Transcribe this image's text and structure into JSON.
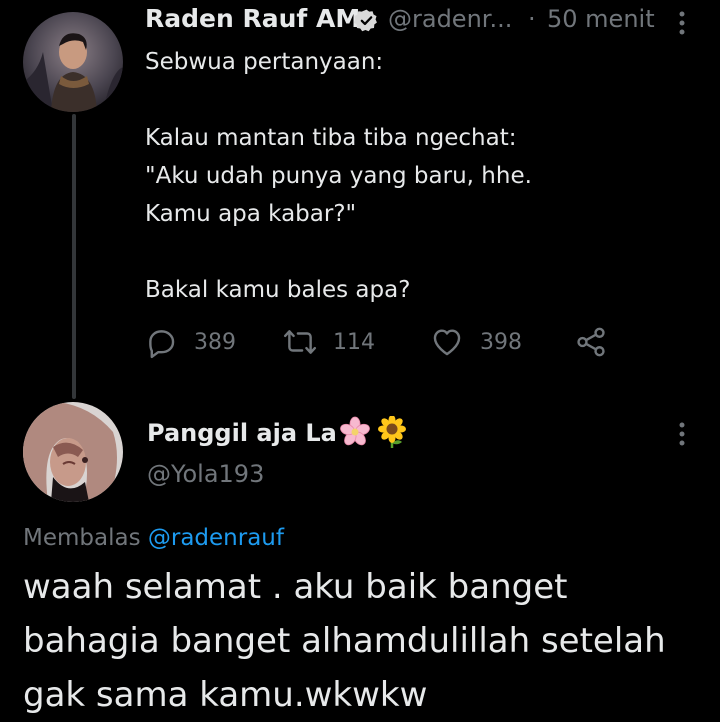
{
  "parent_tweet": {
    "author_name": "Raden Rauf AM",
    "handle": "@radenr...",
    "separator": "·",
    "time": "50 menit",
    "text": "Sebwua pertanyaan:\n\nKalau mantan tiba tiba ngechat:\n\"Aku udah punya yang baru, hhe.\nKamu apa kabar?\"\n\nBakal kamu bales apa?",
    "actions": {
      "reply_count": "389",
      "retweet_count": "114",
      "like_count": "398"
    }
  },
  "reply_tweet": {
    "author_name": "Panggil aja La",
    "emojis": [
      "cherry-blossom",
      "sunflower"
    ],
    "handle": "@Yola193",
    "replying_prefix": "Membalas",
    "replying_to": "@radenrauf",
    "text": "waah selamat . aku baik banget\nbahagia banget alhamdulillah setelah\ngak sama kamu.wkwkw"
  },
  "colors": {
    "background": "#000000",
    "primary_text": "#e7e9ea",
    "secondary_text": "#71767b",
    "accent": "#1d9bf0"
  }
}
